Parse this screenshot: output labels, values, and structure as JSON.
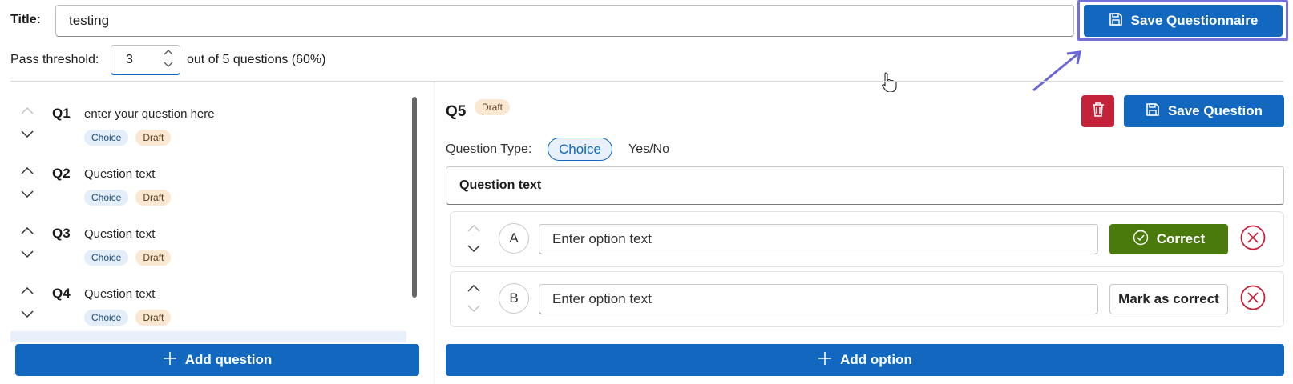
{
  "header": {
    "title_label": "Title:",
    "title_value": "testing",
    "save_questionnaire_label": "Save Questionnaire",
    "pass_threshold_label": "Pass threshold:",
    "pass_threshold_value": "3",
    "pass_threshold_suffix": "out of 5 questions (60%)"
  },
  "questions": [
    {
      "num": "Q1",
      "text": "enter your question here",
      "type": "Choice",
      "status": "Draft"
    },
    {
      "num": "Q2",
      "text": "Question text",
      "type": "Choice",
      "status": "Draft"
    },
    {
      "num": "Q3",
      "text": "Question text",
      "type": "Choice",
      "status": "Draft"
    },
    {
      "num": "Q4",
      "text": "Question text",
      "type": "Choice",
      "status": "Draft"
    }
  ],
  "add_question_label": "Add question",
  "editor": {
    "question_num": "Q5",
    "status": "Draft",
    "save_question_label": "Save Question",
    "question_type_label": "Question Type:",
    "type_choice": "Choice",
    "type_yesno": "Yes/No",
    "question_text": "Question text",
    "options": [
      {
        "letter": "A",
        "placeholder": "Enter option text",
        "correct": true,
        "button_label": "Correct"
      },
      {
        "letter": "B",
        "placeholder": "Enter option text",
        "correct": false,
        "button_label": "Mark as correct"
      }
    ],
    "add_option_label": "Add option"
  },
  "colors": {
    "primary": "#1268be",
    "danger": "#c4213a",
    "success": "#4a7a0c",
    "highlight": "#7470d8"
  }
}
